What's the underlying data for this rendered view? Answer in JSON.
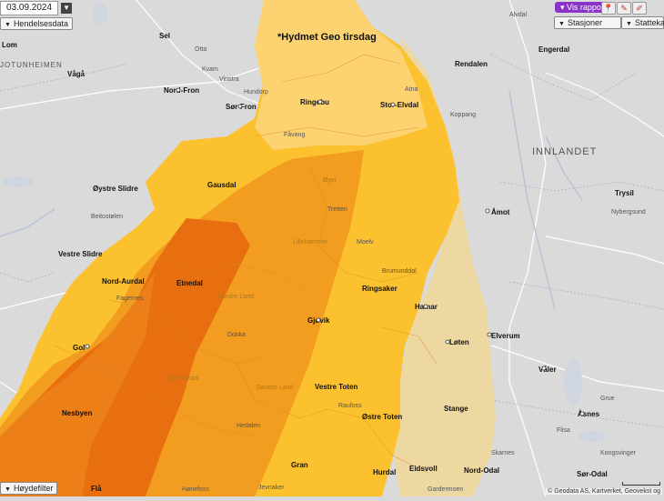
{
  "toolbar": {
    "date": "03.09.2024",
    "report_label": "Vis rapport",
    "left_panel_label": "Hendelsesdata",
    "right_panel_1_label": "Stasjoner",
    "right_panel_2_label": "Stattekart",
    "bottom_panel_label": "Høydefilter"
  },
  "map": {
    "title": "*Hydmet Geo tirsdag",
    "attribution": "© Geodata AS, Kartverket, Geovekst og",
    "warning_colors": {
      "yellow": "#fcc12e",
      "light_yellow": "#fdd270",
      "orange": "#f29c20",
      "red_orange": "#e86f0f",
      "pale": "#f0d79a"
    },
    "regions": [
      "INNLANDET",
      "JOTUNHEIMEN"
    ],
    "places_bold": [
      "Ringebu",
      "Stor-Elvdal",
      "Gausdal",
      "Nord-Fron",
      "Sør-Fron",
      "Øystre Slidre",
      "Vestre Slidre",
      "Nord-Aurdal",
      "Etnedal",
      "Gol",
      "Nesbyen",
      "Ringsaker",
      "Hamar",
      "Gjøvik",
      "Vestre Toten",
      "Østre Toten",
      "Løten",
      "Stange",
      "Åmot",
      "Elverum",
      "Våler",
      "Åsnes",
      "Trysil",
      "Rendalen",
      "Engerdal",
      "Lom",
      "Vågå",
      "Sel",
      "Eidsvoll",
      "Hurdal",
      "Gran",
      "Nord-Odal",
      "Sør-Odal",
      "Flå"
    ],
    "places_mid": [
      "Øyer",
      "Lillehammer",
      "Nordre Land",
      "Søndre Land",
      "Sør-Aurdal",
      "Flå",
      "Ringsaker"
    ],
    "places_small": [
      "Vinstra",
      "Hundorp",
      "Otta",
      "Kvam",
      "Fåvang",
      "Tretten",
      "Fagernes",
      "Beitostølen",
      "Hedalen",
      "Dokka",
      "Raufoss",
      "Brumunddal",
      "Moelv",
      "Gardermoen",
      "Kongsvinger",
      "Koppang",
      "Atna",
      "Alvdal",
      "Nybergsund",
      "Flisa",
      "Skarnes",
      "Grue",
      "Jevnaker",
      "Hønefoss"
    ]
  }
}
